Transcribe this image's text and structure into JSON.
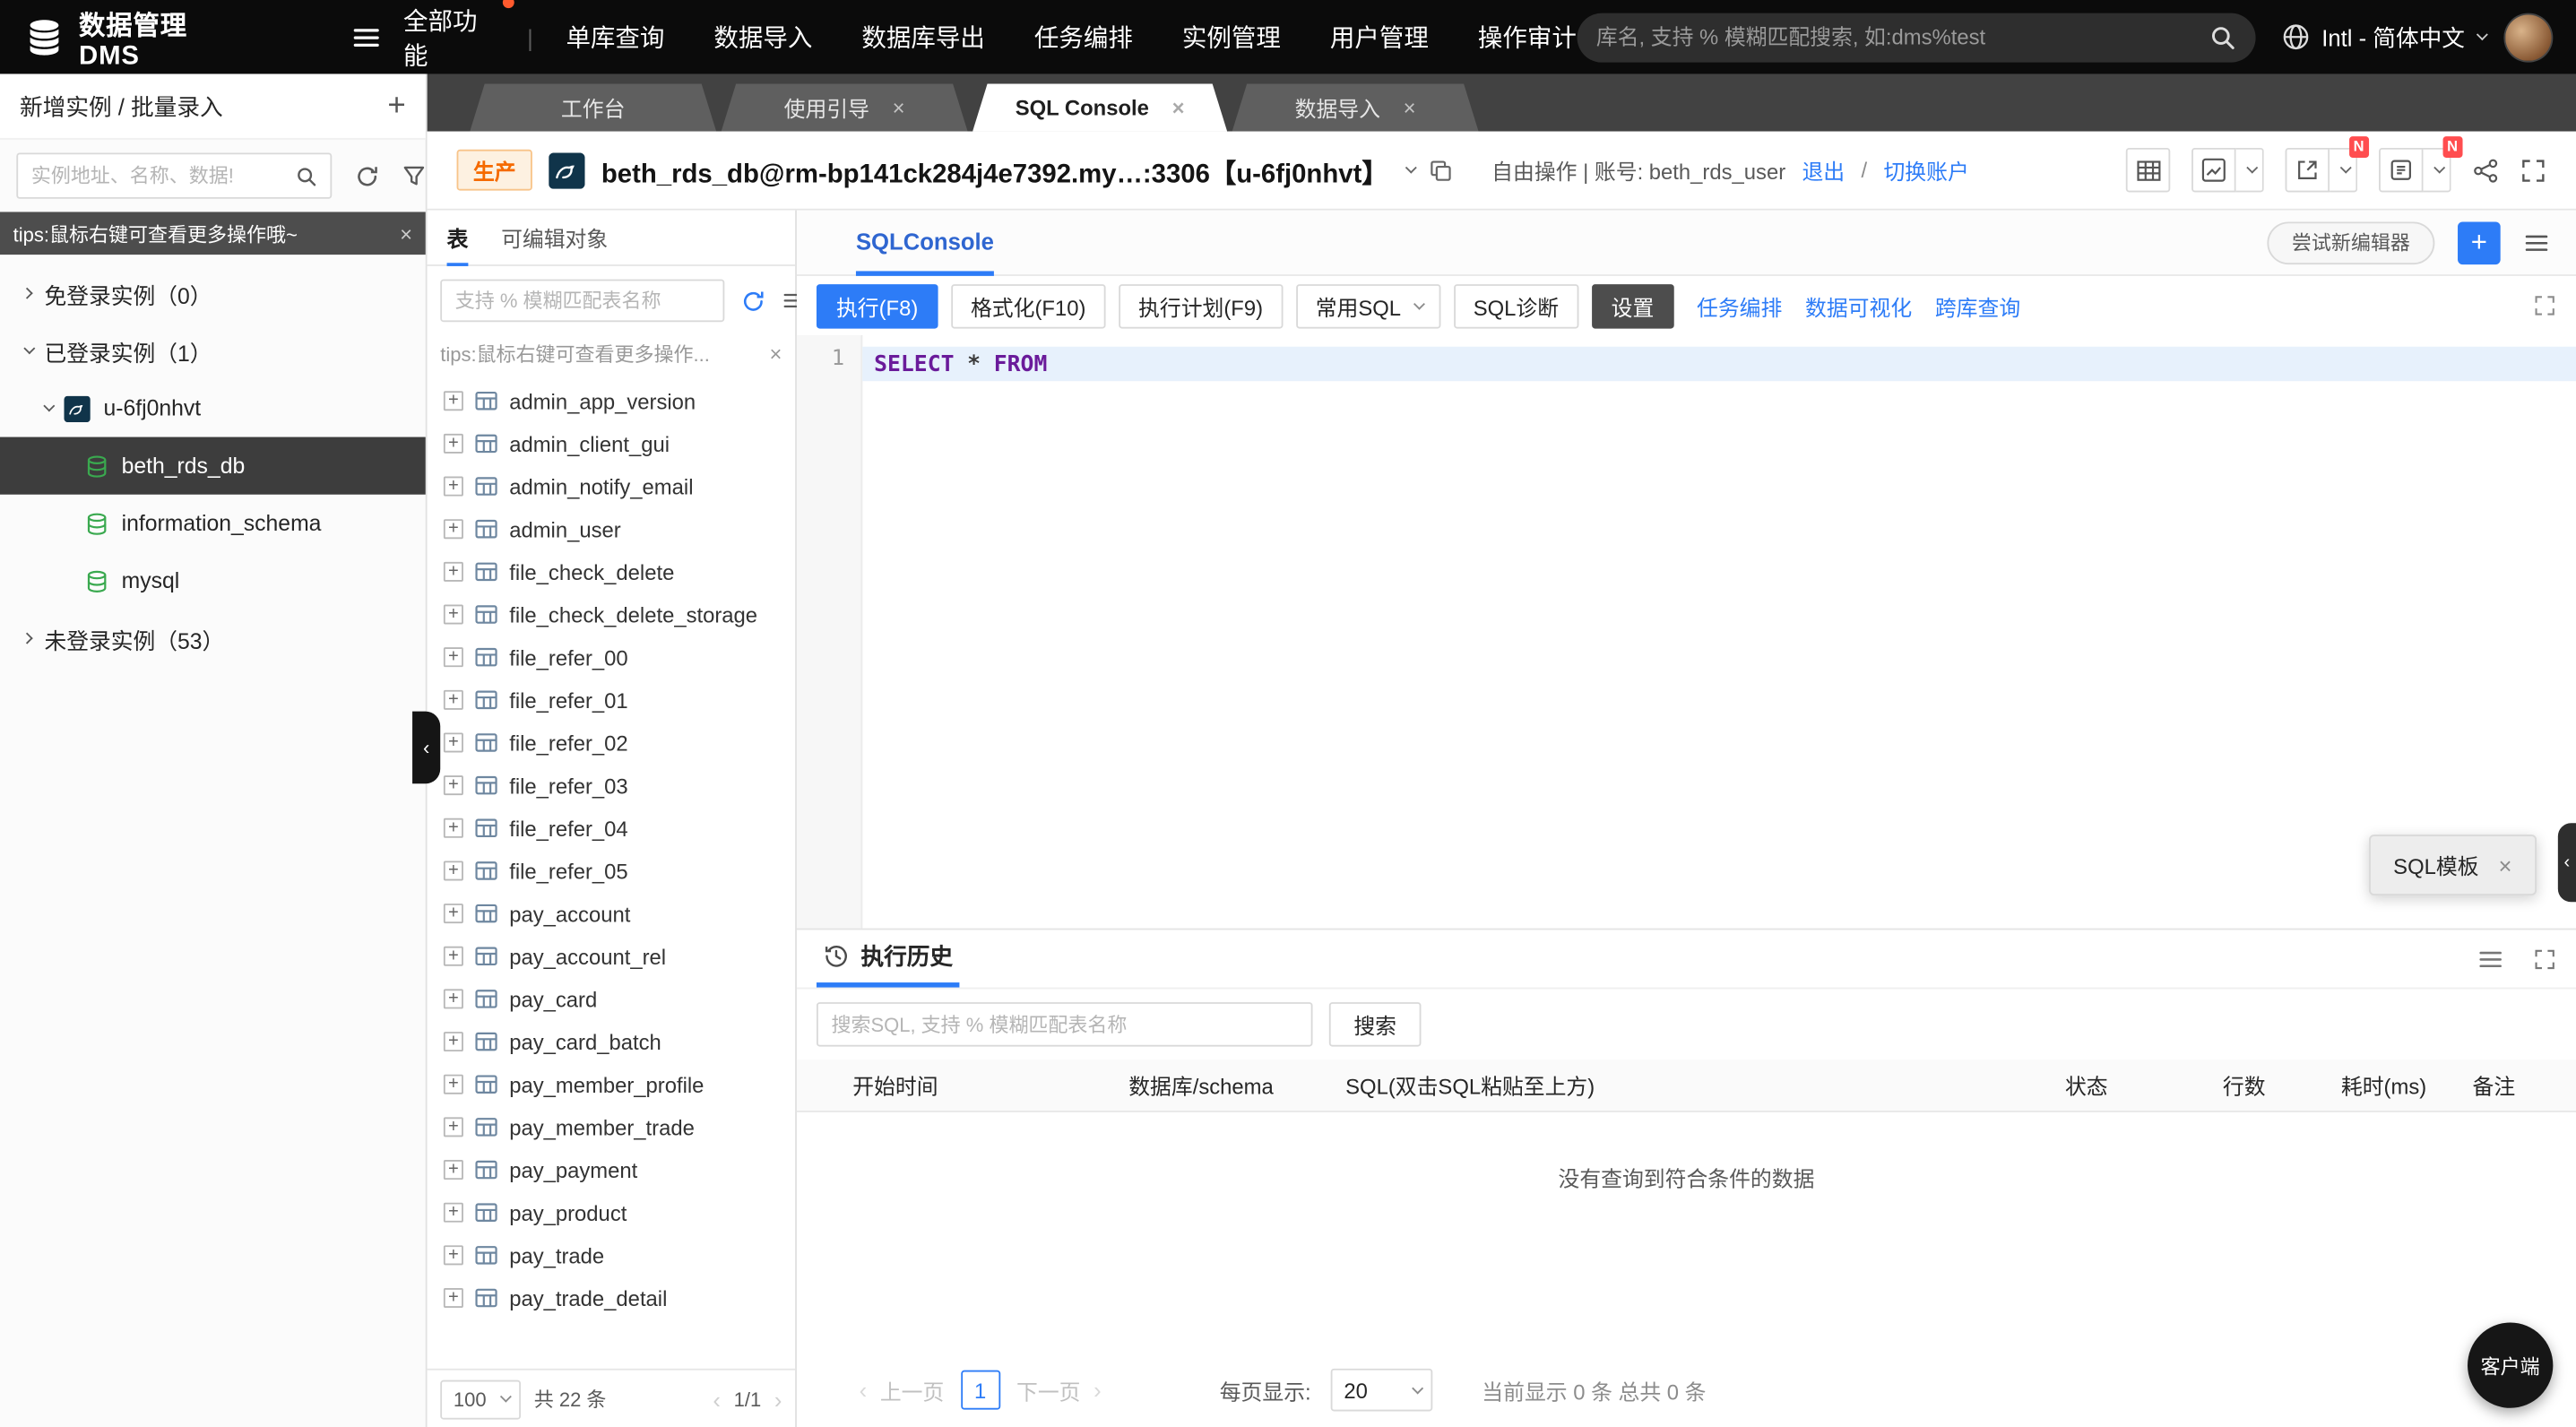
{
  "colors": {
    "accent": "#2d7cf7",
    "env_badge_orange": "#f56a00",
    "new_badge_red": "#ff4d4f",
    "sql_keyword_purple": "#6a1b9a",
    "db_icon_green": "#3aa94f",
    "selected_row_bg": "#3d3d3d"
  },
  "topnav": {
    "brand": "数据管理DMS",
    "all_features": "全部功能",
    "divider": "|",
    "items": [
      "单库查询",
      "数据导入",
      "数据库导出",
      "任务编排",
      "实例管理",
      "用户管理",
      "操作审计"
    ],
    "search_placeholder": "库名, 支持 % 模糊匹配搜索, 如:dms%test",
    "locale": "Intl - 简体中文"
  },
  "tabstrip": {
    "tabs": [
      {
        "label": "工作台"
      },
      {
        "label": "使用引导"
      },
      {
        "label": "SQL Console"
      },
      {
        "label": "数据导入"
      }
    ]
  },
  "instance_bar": {
    "env": "生产",
    "title": "beth_rds_db@rm-bp141ck284j4e7392.my…:3306【u-6fj0nhvt】",
    "meta": "自由操作 | 账号: beth_rds_user",
    "logout": "退出",
    "slash": "/",
    "switch_account": "切换账户",
    "new_badge": "N"
  },
  "sidebar": {
    "header": "新增实例 / 批量录入",
    "search_placeholder": "实例地址、名称、数据!",
    "tips": "tips:鼠标右键可查看更多操作哦~",
    "group_free": "免登录实例（0）",
    "group_logged": "已登录实例（1）",
    "group_unlogged": "未登录实例（53）",
    "instance": "u-6fj0nhvt",
    "db_selected": "beth_rds_db",
    "db_2": "information_schema",
    "db_3": "mysql"
  },
  "table_panel": {
    "tab_tables": "表",
    "tab_editable": "可编辑对象",
    "search_placeholder": "支持 % 模糊匹配表名称",
    "tips": "tips:鼠标右键可查看更多操作...",
    "tables": [
      "admin_app_version",
      "admin_client_gui",
      "admin_notify_email",
      "admin_user",
      "file_check_delete",
      "file_check_delete_storage",
      "file_refer_00",
      "file_refer_01",
      "file_refer_02",
      "file_refer_03",
      "file_refer_04",
      "file_refer_05",
      "pay_account",
      "pay_account_rel",
      "pay_card",
      "pay_card_batch",
      "pay_member_profile",
      "pay_member_trade",
      "pay_payment",
      "pay_product",
      "pay_trade",
      "pay_trade_detail"
    ],
    "page_size": "100",
    "total": "共 22 条",
    "page_indicator": "1/1"
  },
  "console": {
    "tab": "SQLConsole",
    "try_new_editor": "尝试新编辑器",
    "btn_run": "执行(F8)",
    "btn_format": "格式化(F10)",
    "btn_plan": "执行计划(F9)",
    "btn_common_sql": "常用SQL",
    "btn_diagnose": "SQL诊断",
    "btn_settings": "设置",
    "link_task": "任务编排",
    "link_visual": "数据可视化",
    "link_cross": "跨库查询",
    "line_number": "1",
    "sql_kw1": "SELECT",
    "sql_star": "*",
    "sql_kw2": "FROM",
    "sql_template_label": "SQL模板"
  },
  "history": {
    "title": "执行历史",
    "search_placeholder": "搜索SQL, 支持 % 模糊匹配表名称",
    "search_btn": "搜索",
    "columns": [
      "开始时间",
      "数据库/schema",
      "SQL(双击SQL粘贴至上方)",
      "状态",
      "行数",
      "耗时(ms)",
      "备注"
    ],
    "empty": "没有查询到符合条件的数据",
    "prev": "上一页",
    "page": "1",
    "next": "下一页",
    "per_page_label": "每页显示:",
    "per_page": "20",
    "summary": "当前显示 0 条 总共 0 条"
  },
  "fab": {
    "label": "客户端"
  }
}
